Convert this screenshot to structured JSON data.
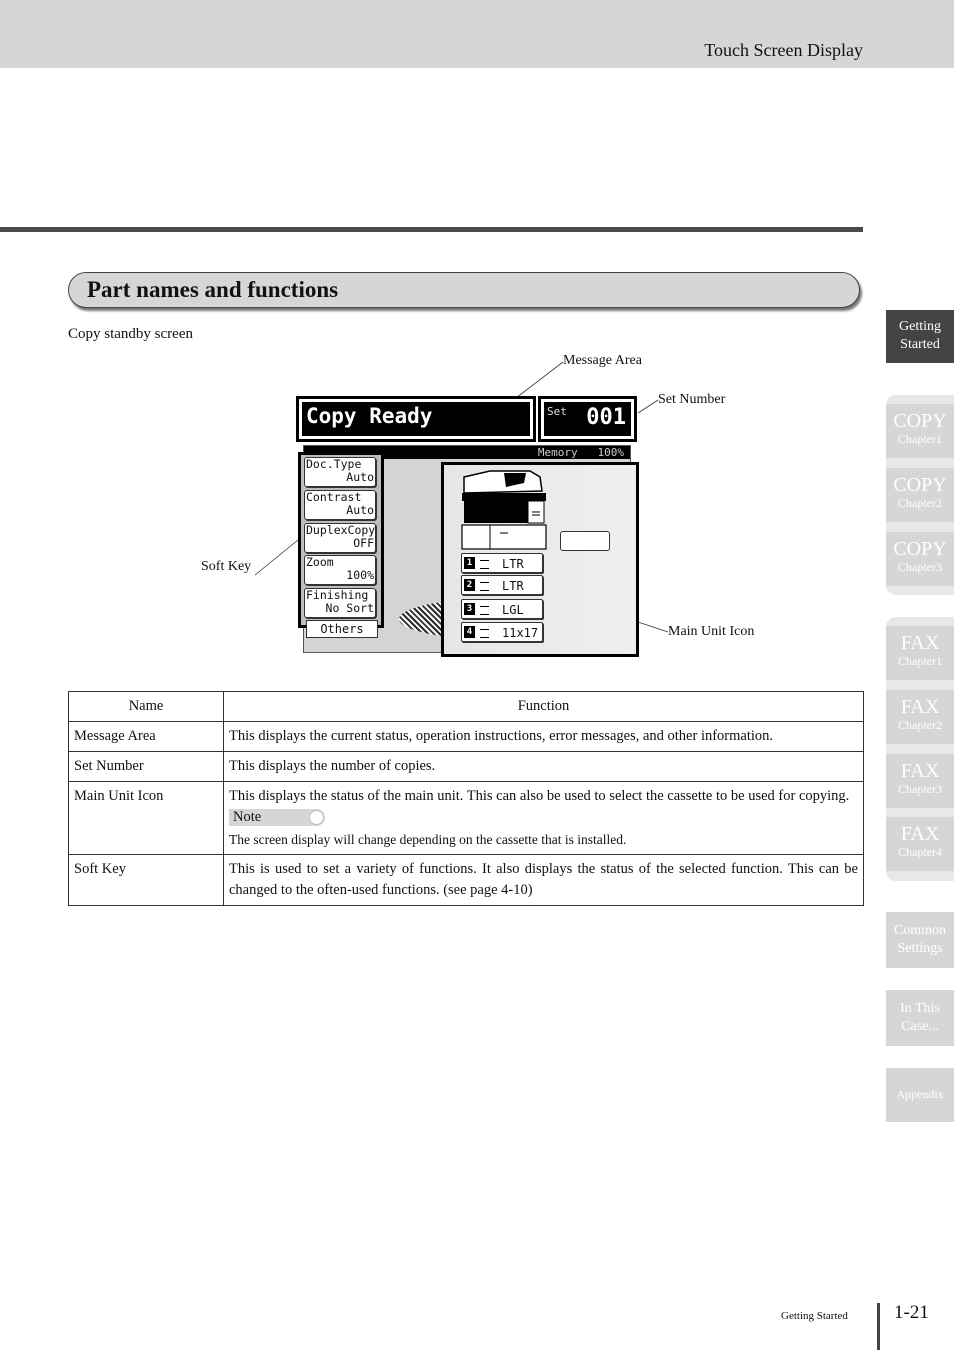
{
  "header": {
    "title": "Touch Screen Display"
  },
  "section": {
    "heading": "Part names and functions",
    "caption": "Copy standby screen"
  },
  "callouts": {
    "message_area": "Message Area",
    "set_number": "Set Number",
    "soft_key": "Soft Key",
    "main_unit_icon": "Main Unit Icon"
  },
  "screen": {
    "message": "Copy Ready",
    "set_label": "Set",
    "set_value": "001",
    "memory": "Memory   100%",
    "soft_keys": [
      {
        "key": "Doc.Type",
        "value": "Auto"
      },
      {
        "key": "Contrast",
        "value": "Auto"
      },
      {
        "key": "DuplexCopy",
        "value": "OFF"
      },
      {
        "key": "Zoom",
        "value": "100%"
      },
      {
        "key": "Finishing",
        "value": "No Sort"
      }
    ],
    "others": "Others",
    "trays": [
      {
        "num": "1",
        "size": "LTR"
      },
      {
        "num": "2",
        "size": "LTR"
      },
      {
        "num": "3",
        "size": "LGL"
      },
      {
        "num": "4",
        "size": "11x17"
      }
    ]
  },
  "table": {
    "headers": [
      "Name",
      "Function"
    ],
    "rows": [
      {
        "name": "Message Area",
        "function": "This displays the current status, operation instructions, error messages, and other information."
      },
      {
        "name": "Set Number",
        "function": "This displays the number of copies."
      },
      {
        "name": "Main Unit Icon",
        "function": "This displays the status of the main unit. This can also be used to select the cassette to be used for copying.",
        "note_label": "Note",
        "note": "The screen display will change depending on the cassette that is installed."
      },
      {
        "name": "Soft Key",
        "function": "This is used to set a variety of functions. It also displays the status of the selected function. This can be changed to the often-used functions. (see page 4-10)"
      }
    ]
  },
  "side_tabs": {
    "getting_started": [
      "Getting",
      "Started"
    ],
    "copy": [
      {
        "title": "COPY",
        "sub": "Chapter1"
      },
      {
        "title": "COPY",
        "sub": "Chapter2"
      },
      {
        "title": "COPY",
        "sub": "Chapter3"
      }
    ],
    "fax": [
      {
        "title": "FAX",
        "sub": "Chapter1"
      },
      {
        "title": "FAX",
        "sub": "Chapter2"
      },
      {
        "title": "FAX",
        "sub": "Chapter3"
      },
      {
        "title": "FAX",
        "sub": "Chapter4"
      }
    ],
    "common_settings": [
      "Common",
      "Settings"
    ],
    "in_this_case": [
      "In This",
      "Case..."
    ],
    "appendix": "Appendix"
  },
  "footer": {
    "section": "Getting Started",
    "page": "1-21"
  }
}
